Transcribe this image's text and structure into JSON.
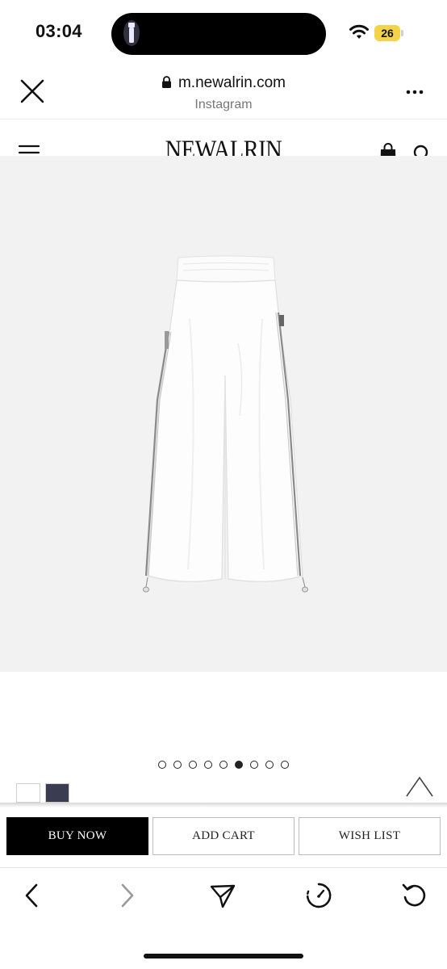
{
  "status_bar": {
    "time": "03:04",
    "battery": "26",
    "battery_color": "#f3d34a"
  },
  "browser": {
    "url": "m.newalrin.com",
    "source": "Instagram",
    "icons": [
      "close-icon",
      "lock-icon",
      "more-icon"
    ]
  },
  "site": {
    "brand": "NEWALRIN",
    "icons": [
      "menu-icon",
      "shopping-bag-icon",
      "search-icon"
    ]
  },
  "product": {
    "image_alt": "white-wide-leg-pants",
    "carousel": {
      "total": 9,
      "active_index": 5
    },
    "swatches": [
      {
        "name": "white",
        "color": "#ffffff"
      },
      {
        "name": "navy",
        "color": "#3a3d52"
      }
    ]
  },
  "actions": {
    "buy_now": "BUY NOW",
    "add_cart": "ADD CART",
    "wish_list": "WISH LIST"
  },
  "toolbar": {
    "icons": [
      "back-icon",
      "forward-icon",
      "share-icon",
      "speed-icon",
      "reload-icon"
    ]
  }
}
